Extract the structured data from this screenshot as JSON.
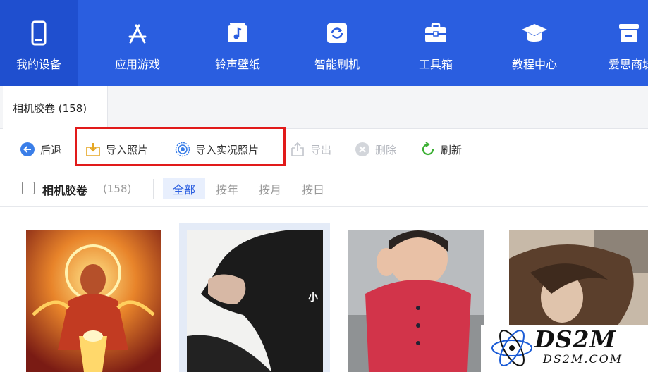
{
  "nav": {
    "items": [
      {
        "label": "我的设备",
        "icon": "phone-icon"
      },
      {
        "label": "应用游戏",
        "icon": "app-store-icon"
      },
      {
        "label": "铃声壁纸",
        "icon": "music-icon"
      },
      {
        "label": "智能刷机",
        "icon": "refresh-box-icon"
      },
      {
        "label": "工具箱",
        "icon": "toolbox-icon"
      },
      {
        "label": "教程中心",
        "icon": "graduation-cap-icon"
      },
      {
        "label": "爱思商城",
        "icon": "store-icon"
      }
    ]
  },
  "tab": {
    "label": "相机胶卷 (158)"
  },
  "toolbar": {
    "back": "后退",
    "import_photos": "导入照片",
    "import_live": "导入实况照片",
    "export": "导出",
    "delete": "删除",
    "refresh": "刷新"
  },
  "filter": {
    "album": "相机胶卷",
    "count": "(158)",
    "tabs": [
      "全部",
      "按年",
      "按月",
      "按日"
    ],
    "selected": "全部"
  },
  "watermark": {
    "main": "DS2M",
    "sub": "DS2M.COM",
    "overlay": "小"
  },
  "colors": {
    "accent": "#2a5ee0",
    "highlight": "#e11a1a"
  }
}
